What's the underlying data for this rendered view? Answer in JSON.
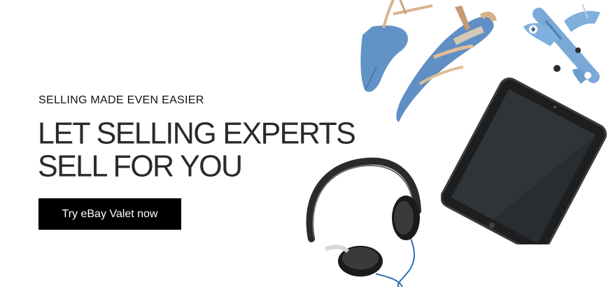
{
  "banner": {
    "eyebrow": "SELLING MADE EVEN EASIER",
    "headline_line1": "LET SELLING EXPERTS",
    "headline_line2": "SELL FOR YOU",
    "cta_label": "Try eBay Valet now"
  },
  "colors": {
    "background": "#ffffff",
    "cta_background": "#000000",
    "cta_text": "#ffffff",
    "headline": "#2a2a2a",
    "shoe_blue": "#5f8fc4",
    "plane_blue": "#7aa9d8",
    "tablet_body": "#1c1e20"
  },
  "icons": [
    "shoes-image",
    "toy-plane-image",
    "tablet-image",
    "headphones-image"
  ]
}
